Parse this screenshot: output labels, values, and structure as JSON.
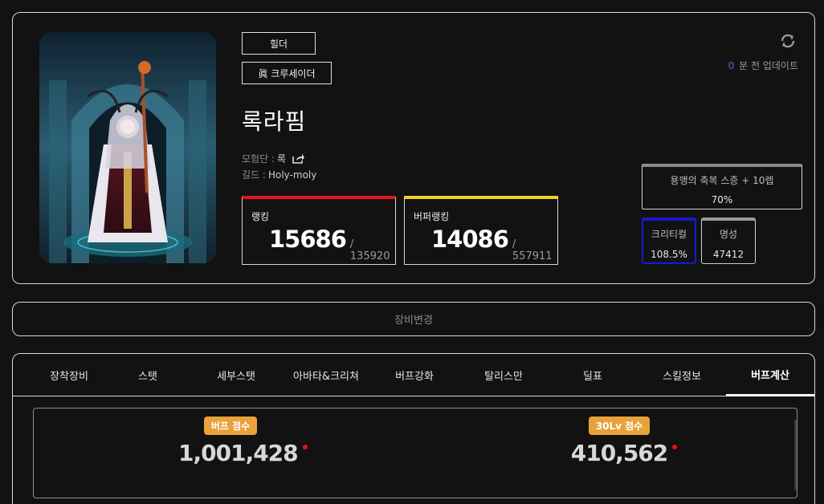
{
  "profile": {
    "job_tag": "힐더",
    "adv_tag": "眞 크루세이더",
    "name": "록라핌",
    "adventure_label": "모험단 : ",
    "adventure_value": "록",
    "guild_label": "길드 : ",
    "guild_value": "Holy-moly"
  },
  "ranking": {
    "label": "랭킹",
    "value": "15686",
    "total": "/ 135920",
    "accent": "#e0151c"
  },
  "buffer_ranking": {
    "label": "버퍼랭킹",
    "value": "14086",
    "total": "/ 557911",
    "accent": "#f1d120"
  },
  "update": {
    "count": "0",
    "text": "분 전 업데이트"
  },
  "buff_skill": {
    "title": "용맹의 축복 스증 + 10렙",
    "value": "70%"
  },
  "stats": {
    "crit_label": "크리티컬",
    "crit_value": "108.5%",
    "fame_label": "명성",
    "fame_value": "47412"
  },
  "equip_change": "장비변경",
  "tabs": [
    {
      "label": "장착장비"
    },
    {
      "label": "스탯"
    },
    {
      "label": "세부스탯"
    },
    {
      "label": "아바타&크리쳐"
    },
    {
      "label": "버프강화"
    },
    {
      "label": "탈리스만"
    },
    {
      "label": "딜표"
    },
    {
      "label": "스킬정보"
    },
    {
      "label": "버프계산"
    }
  ],
  "active_tab": 8,
  "scores": {
    "buff_label": "버프 점수",
    "buff_value": "1,001,428",
    "lv30_label": "30Lv 점수",
    "lv30_value": "410,562"
  },
  "colors": {
    "badge": "#e9a13a",
    "crit_border": "#1818d6",
    "update_count": "#5c63c8"
  }
}
